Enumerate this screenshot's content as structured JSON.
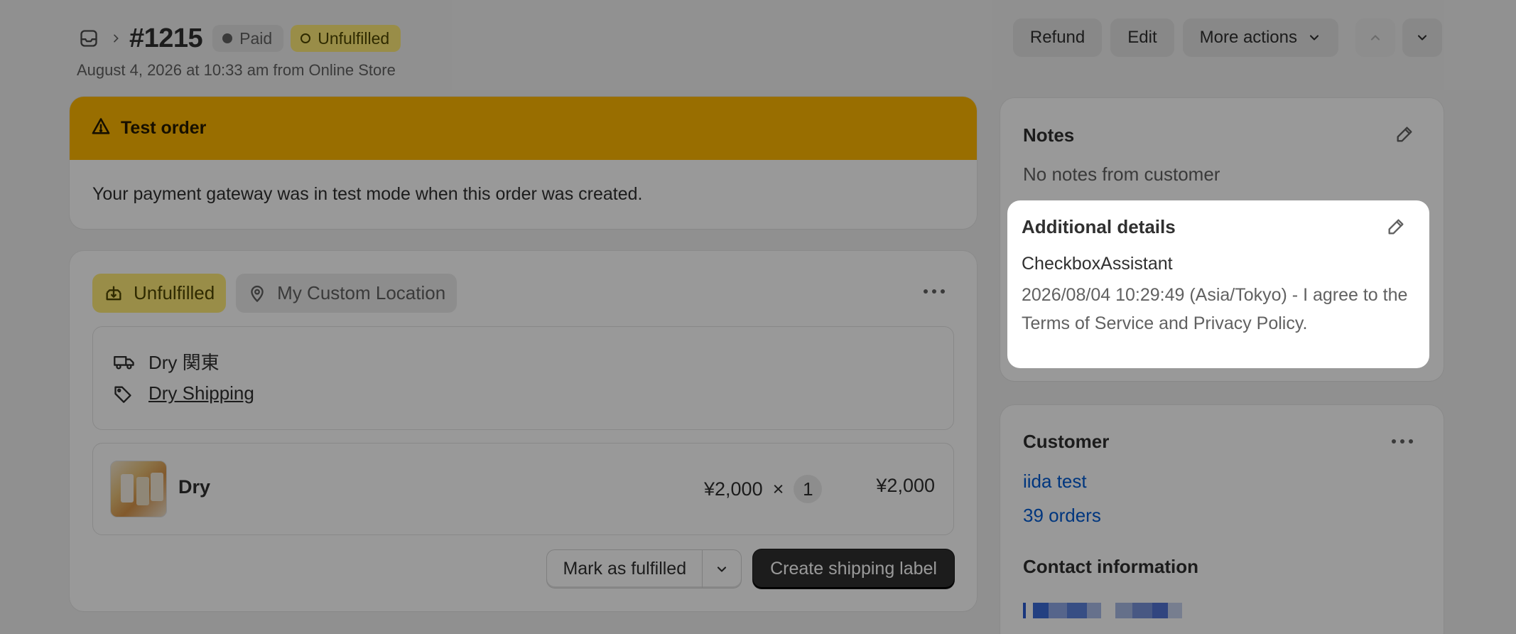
{
  "header": {
    "order_number": "#1215",
    "payment_badge": "Paid",
    "fulfillment_badge": "Unfulfilled",
    "subtitle": "August 4, 2026 at 10:33 am from Online Store",
    "actions": {
      "refund": "Refund",
      "edit": "Edit",
      "more_actions": "More actions"
    },
    "icons": {
      "orders": "orders-inbox-icon",
      "breadcrumb": "chevron-right-icon",
      "prev": "chevron-up-icon",
      "next": "chevron-down-icon"
    }
  },
  "test_banner": {
    "title": "Test order",
    "message": "Your payment gateway was in test mode when this order was created.",
    "icon": "alert-triangle-icon",
    "color": "#ffb800"
  },
  "fulfillment": {
    "status": "Unfulfilled",
    "location": "My Custom Location",
    "shipping": {
      "method": "Dry 関東",
      "rate_link": "Dry Shipping"
    },
    "item": {
      "name": "Dry",
      "unit_price": "¥2,000",
      "times": "×",
      "quantity": "1",
      "total": "¥2,000"
    },
    "actions": {
      "mark_fulfilled": "Mark as fulfilled",
      "create_label": "Create shipping label"
    }
  },
  "notes": {
    "title": "Notes",
    "text": "No notes from customer"
  },
  "additional_details": {
    "title": "Additional details",
    "key": "CheckboxAssistant",
    "value": "2026/08/04 10:29:49 (Asia/Tokyo) - I agree to the Terms of Service and Privacy Policy."
  },
  "customer": {
    "title": "Customer",
    "name_link": "iida test",
    "orders_link": "39 orders",
    "contact_title": "Contact information"
  },
  "colors": {
    "accent_link": "#005bd3",
    "warning": "#ffb800",
    "unfulfilled_badge": "#ffeb78"
  }
}
